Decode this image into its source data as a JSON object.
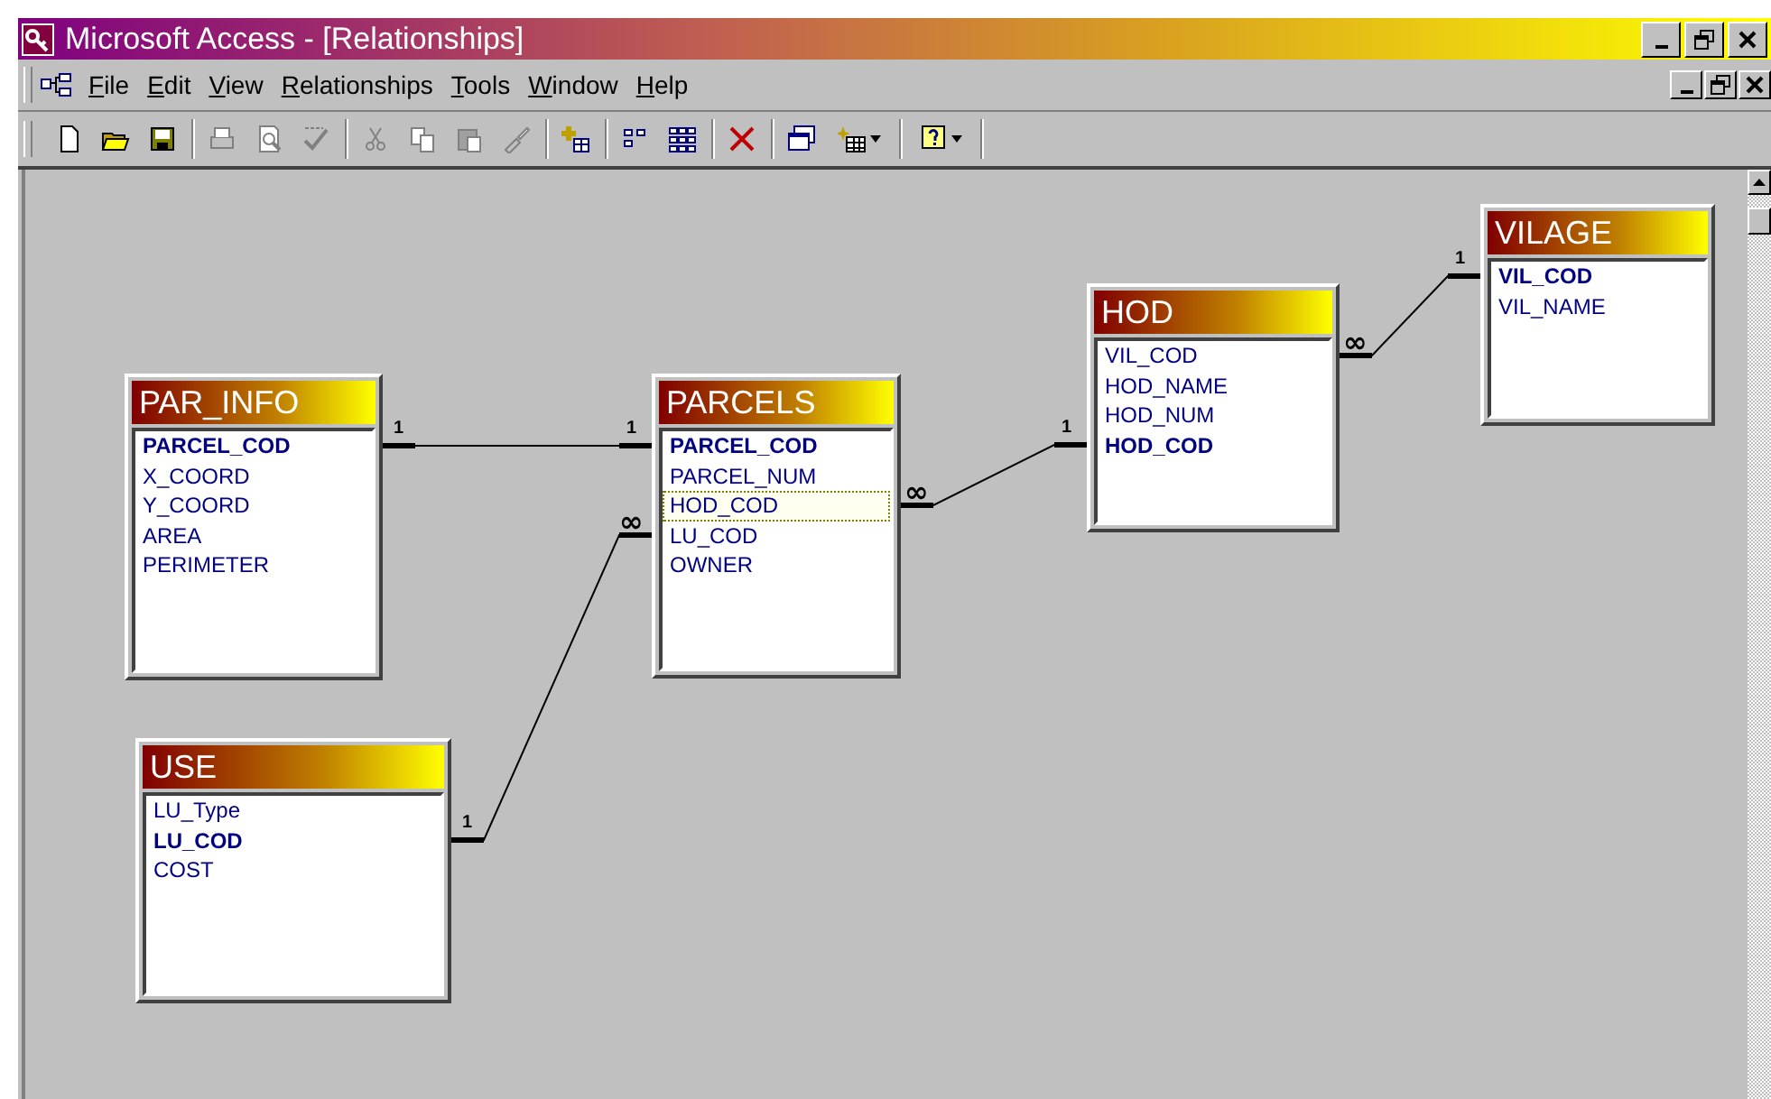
{
  "window": {
    "title": "Microsoft Access - [Relationships]"
  },
  "menu": [
    {
      "label": "File"
    },
    {
      "label": "Edit"
    },
    {
      "label": "View"
    },
    {
      "label": "Relationships"
    },
    {
      "label": "Tools"
    },
    {
      "label": "Window"
    },
    {
      "label": "Help"
    }
  ],
  "toolbar": [
    [
      {
        "kind": "new",
        "disabled": false
      },
      {
        "kind": "open",
        "disabled": false
      },
      {
        "kind": "save",
        "disabled": false
      }
    ],
    [
      {
        "kind": "print",
        "disabled": true
      },
      {
        "kind": "preview",
        "disabled": true
      },
      {
        "kind": "spelling",
        "disabled": true
      }
    ],
    [
      {
        "kind": "cut",
        "disabled": true
      },
      {
        "kind": "copy",
        "disabled": true
      },
      {
        "kind": "paste",
        "disabled": true
      },
      {
        "kind": "brush",
        "disabled": true
      }
    ],
    [
      {
        "kind": "show-table",
        "disabled": false
      }
    ],
    [
      {
        "kind": "direct",
        "disabled": false
      },
      {
        "kind": "all",
        "disabled": false
      }
    ],
    [
      {
        "kind": "delete",
        "disabled": false
      }
    ],
    [
      {
        "kind": "windows",
        "disabled": false
      },
      {
        "kind": "new-object",
        "disabled": false,
        "dropdown": true
      }
    ],
    [
      {
        "kind": "help",
        "disabled": false,
        "dropdown": true
      }
    ]
  ],
  "tables": [
    {
      "name": "PAR_INFO",
      "fields": [
        {
          "name": "PARCEL_COD",
          "key": true,
          "selected": false
        },
        {
          "name": "X_COORD",
          "key": false,
          "selected": false
        },
        {
          "name": "Y_COORD",
          "key": false,
          "selected": false
        },
        {
          "name": "AREA",
          "key": false,
          "selected": false
        },
        {
          "name": "PERIMETER",
          "key": false,
          "selected": false
        }
      ]
    },
    {
      "name": "PARCELS",
      "fields": [
        {
          "name": "PARCEL_COD",
          "key": true,
          "selected": false
        },
        {
          "name": "PARCEL_NUM",
          "key": false,
          "selected": false
        },
        {
          "name": "HOD_COD",
          "key": false,
          "selected": true
        },
        {
          "name": "LU_COD",
          "key": false,
          "selected": false
        },
        {
          "name": "OWNER",
          "key": false,
          "selected": false
        }
      ]
    },
    {
      "name": "HOD",
      "fields": [
        {
          "name": "VIL_COD",
          "key": false,
          "selected": false
        },
        {
          "name": "HOD_NAME",
          "key": false,
          "selected": false
        },
        {
          "name": "HOD_NUM",
          "key": false,
          "selected": false
        },
        {
          "name": "HOD_COD",
          "key": true,
          "selected": false
        }
      ]
    },
    {
      "name": "VILAGE",
      "fields": [
        {
          "name": "VIL_COD",
          "key": true,
          "selected": false
        },
        {
          "name": "VIL_NAME",
          "key": false,
          "selected": false
        }
      ]
    },
    {
      "name": "USE",
      "fields": [
        {
          "name": "LU_Type",
          "key": false,
          "selected": false
        },
        {
          "name": "LU_COD",
          "key": true,
          "selected": false
        },
        {
          "name": "COST",
          "key": false,
          "selected": false
        }
      ]
    }
  ],
  "relationships": [
    {
      "from_label": "1",
      "to_label": "1"
    },
    {
      "from_label": "1",
      "to_label": "∞"
    },
    {
      "from_label": "∞",
      "to_label": "1"
    },
    {
      "from_label": "∞",
      "to_label": "1"
    }
  ]
}
